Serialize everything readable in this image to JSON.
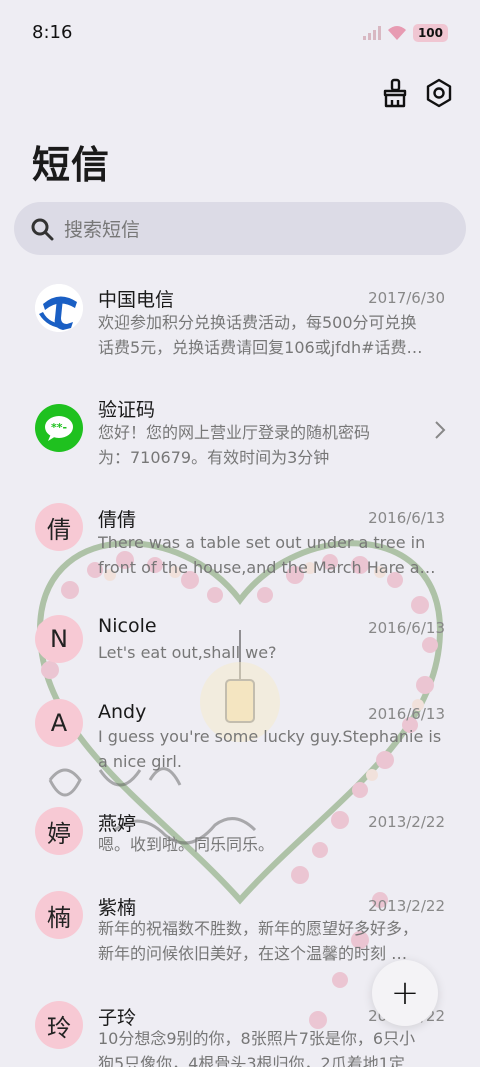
{
  "status": {
    "time": "8:16",
    "battery": "100"
  },
  "title": "短信",
  "search": {
    "placeholder": "搜索短信"
  },
  "messages": [
    {
      "name": "中国电信",
      "date": "2017/6/30",
      "avatar": "",
      "avatar_type": "telecom-logo",
      "line1": "欢迎参加积分兑换话费活动，每500分可兑换",
      "line2": "话费5元，兑换话费请回复106或jfdh#话费…"
    },
    {
      "name": "验证码",
      "date": "",
      "avatar": "",
      "avatar_type": "message-icon",
      "line1": "您好！您的网上营业厅登录的随机密码",
      "line2": "为：710679。有效时间为3分钟"
    },
    {
      "name": "倩倩",
      "date": "2016/6/13",
      "avatar": "倩",
      "line1": "There was a table set out under a tree in",
      "line2": "front of the house,and the March Hare an…"
    },
    {
      "name": "Nicole",
      "date": "2016/6/13",
      "avatar": "N",
      "line1": "Let's eat out,shall we?",
      "line2": ""
    },
    {
      "name": "Andy",
      "date": "2016/6/13",
      "avatar": "A",
      "line1": "I guess you're some lucky guy.Stephanie is",
      "line2": "a nice girl."
    },
    {
      "name": "燕婷",
      "date": "2013/2/22",
      "avatar": "婷",
      "line1": "嗯。收到啦。同乐同乐。",
      "line2": ""
    },
    {
      "name": "紫楠",
      "date": "2013/2/22",
      "avatar": "楠",
      "line1": "新年的祝福数不胜数，新年的愿望好多好多，",
      "line2": "新年的问候依旧美好，在这个温馨的时刻 …"
    },
    {
      "name": "子玲",
      "date": "2013/2/22",
      "avatar": "玲",
      "line1": "10分想念9别的你，8张照片7张是你，6只小",
      "line2": "狗5只像你，4根骨头3根归你，2爪着地1定"
    }
  ],
  "fab": {
    "label": "+"
  },
  "colors": {
    "background": "#eeedf3",
    "search_bg": "#dcdbe6",
    "avatar_pink": "#f7c9d4",
    "telecom_blue": "#1a5fc4",
    "message_green": "#1fc11f"
  }
}
